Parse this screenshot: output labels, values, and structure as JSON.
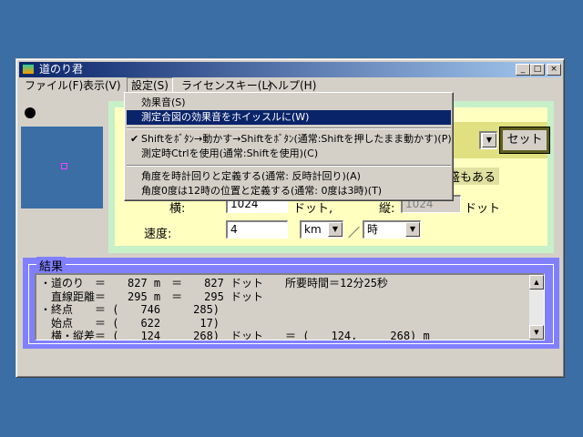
{
  "window": {
    "title": "道のり君",
    "controls": {
      "minimize": "_",
      "maximize": "□",
      "close": "×"
    }
  },
  "menu": {
    "file": "ファイル(F)",
    "view": "表示(V)",
    "settings": "設定(S)",
    "license": "ライセンスキー(L)",
    "help": "ヘルプ(H)"
  },
  "settings_menu": {
    "items": [
      "効果音(S)",
      "測定合図の効果音をホイッスルに(W)",
      "Shiftをﾎﾞﾀﾝ→動かす→Shiftをﾎﾞﾀﾝ(通常:Shiftを押したまま動かす)(P)",
      "測定時Ctrlを使用(通常:Shiftを使用)(C)",
      "角度を時計回りと定義する(通常: 反時計回り)(A)",
      "角度0度は12時の位置と定義する(通常: 0度は3時)(T)"
    ],
    "checked_mark": "✔"
  },
  "form": {
    "partial_label": "盛もある",
    "width_label": "横:",
    "width_value": "1024",
    "dot_label_1": "ドット,",
    "height_label": "縦:",
    "height_value": "1024",
    "dot_label_2": "ドット",
    "speed_label": "速度:",
    "speed_value": "4",
    "speed_unit": "km",
    "slash": "／",
    "time_unit": "時",
    "set_button": "セット"
  },
  "result": {
    "legend": "結果",
    "lines": [
      "・道のり　＝　　827 m　＝　　827 ドット　　所要時間＝12分25秒",
      "　直線距離＝　　295 m　＝　　295 ドット",
      "・終点　　＝ (　　746　　　285)",
      "　始点　　＝ (　　622　　　 17)",
      "　横・縦差＝ (　　124　　　268)　ドット　　＝ (　　124,　　　268) m"
    ]
  }
}
